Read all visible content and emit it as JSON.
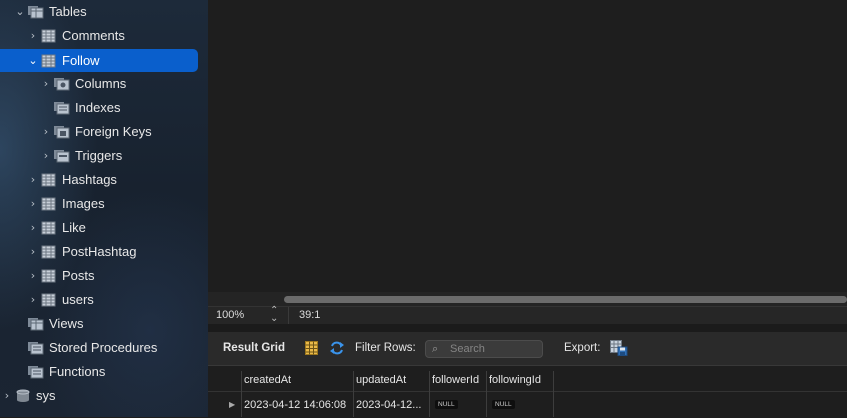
{
  "sidebar": {
    "tables_label": "Tables",
    "items": [
      {
        "label": "Comments"
      },
      {
        "label": "Follow"
      },
      {
        "label": "Columns"
      },
      {
        "label": "Indexes"
      },
      {
        "label": "Foreign Keys"
      },
      {
        "label": "Triggers"
      },
      {
        "label": "Hashtags"
      },
      {
        "label": "Images"
      },
      {
        "label": "Like"
      },
      {
        "label": "PostHashtag"
      },
      {
        "label": "Posts"
      },
      {
        "label": "users"
      }
    ],
    "views_label": "Views",
    "stored_procedures_label": "Stored Procedures",
    "functions_label": "Functions",
    "sys_label": "sys",
    "selected_color": "#0a5fcc"
  },
  "statusbar": {
    "zoom": "100%",
    "cursor_position": "39:1"
  },
  "result_toolbar": {
    "title": "Result Grid",
    "filter_label": "Filter Rows:",
    "search_placeholder": "Search",
    "export_label": "Export:"
  },
  "grid": {
    "columns": [
      "createdAt",
      "updatedAt",
      "followerId",
      "followingId"
    ],
    "rows": [
      {
        "createdAt": "2023-04-12 14:06:08",
        "updatedAt": "2023-04-12...",
        "followerId": "NULL",
        "followingId": "NULL"
      }
    ]
  }
}
